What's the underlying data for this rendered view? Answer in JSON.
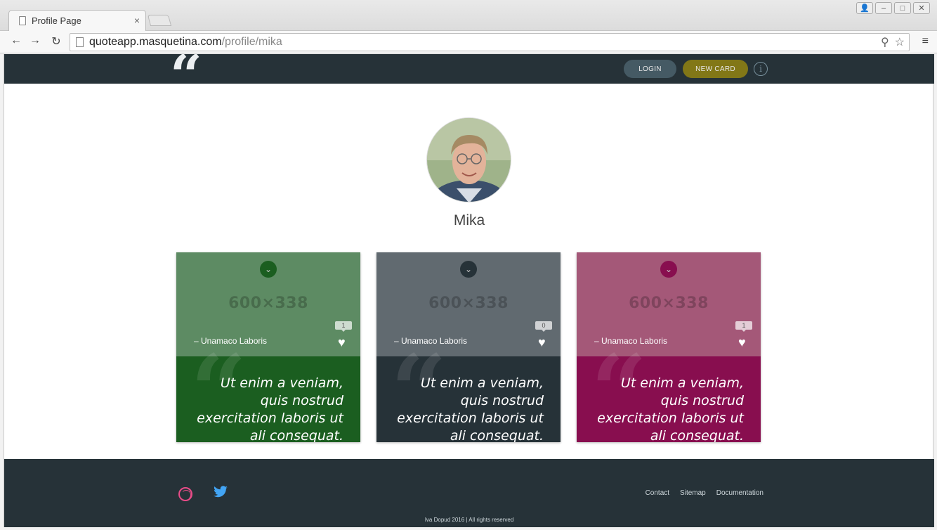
{
  "browser": {
    "tab_title": "Profile Page",
    "tab_close": "×",
    "url_host": "quoteapp.masquetina.com",
    "url_path": "/profile/mika",
    "back": "←",
    "forward": "→",
    "reload": "↻",
    "zoom": "⚲",
    "star": "☆",
    "menu": "≡",
    "win_user": "👤",
    "win_min": "–",
    "win_max": "□",
    "win_close": "✕"
  },
  "header": {
    "logo": "“",
    "login_label": "LOGIN",
    "new_card_label": "NEW CARD",
    "info_label": "i"
  },
  "profile": {
    "name": "Mika"
  },
  "cards": [
    {
      "placeholder": "600×338",
      "author": "– Unamaco Laboris",
      "likes": "1",
      "quote": "Ut enim a veniam, quis nostrud exercitation laboris ut ali consequat.",
      "top_color": "#5d8b63",
      "bottom_color": "#1b5e20",
      "chevron_color": "#1b5e20"
    },
    {
      "placeholder": "600×338",
      "author": "– Unamaco Laboris",
      "likes": "0",
      "quote": "Ut enim a veniam, quis nostrud exercitation laboris ut ali consequat.",
      "top_color": "#616a70",
      "bottom_color": "#263238",
      "chevron_color": "#263238"
    },
    {
      "placeholder": "600×338",
      "author": "– Unamaco Laboris",
      "likes": "1",
      "quote": "Ut enim a veniam, quis nostrud exercitation laboris ut ali consequat.",
      "top_color": "#a45878",
      "bottom_color": "#880e4f",
      "chevron_color": "#880e4f"
    }
  ],
  "footer": {
    "links": [
      "Contact",
      "Sitemap",
      "Documentation"
    ],
    "copyright": "Iva Dopud 2016 | All rights reserved"
  }
}
